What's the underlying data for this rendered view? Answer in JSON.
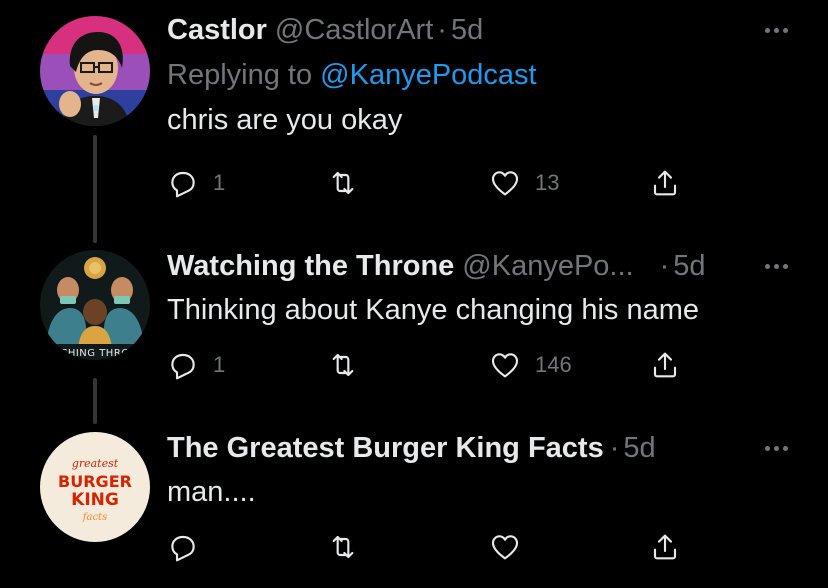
{
  "tweets": [
    {
      "name": "Castlor",
      "handle": "@CastlorArt",
      "dot": "·",
      "time": "5d",
      "replying_prefix": "Replying to ",
      "replying_mention": "@KanyePodcast",
      "text": "chris are you okay",
      "replies": "1",
      "retweets": "",
      "likes": "13",
      "avatar_icon": "artist-avatar-illustration",
      "avatar_colors": [
        "#d6307f",
        "#9b4fb8",
        "#2f3f9e"
      ]
    },
    {
      "name": "Watching the Throne",
      "handle": "@KanyePo...",
      "dot": "·",
      "time": "5d",
      "text": "Thinking about Kanye changing his name",
      "replies": "1",
      "retweets": "",
      "likes": "146",
      "avatar_icon": "podcast-logo-illustration",
      "avatar_text": "CHING THRO",
      "avatar_colors": [
        "#1c3b3a",
        "#d9a441",
        "#2d6f6a"
      ]
    },
    {
      "name": "The Greatest Burger King Facts",
      "dot": "·",
      "time": "5d",
      "text": "man....",
      "replies": "",
      "retweets": "",
      "likes": "",
      "avatar_icon": "burger-king-logo",
      "avatar_logo_top": "greatest",
      "avatar_logo_line1": "BURGER",
      "avatar_logo_line2": "KING",
      "avatar_logo_bottom": "facts",
      "avatar_colors": [
        "#f5ebdc",
        "#d62300",
        "#ff8732"
      ]
    }
  ],
  "icons": {
    "reply": "reply-icon",
    "retweet": "retweet-icon",
    "like": "heart-icon",
    "share": "share-icon",
    "more": "more-icon"
  }
}
